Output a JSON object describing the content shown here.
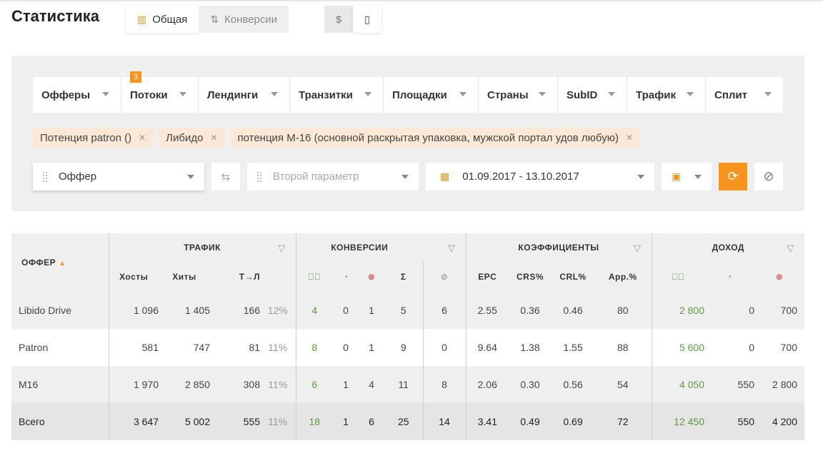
{
  "header": {
    "title": "Статистика",
    "tabs": [
      {
        "label": "Общая",
        "icon": "bar-chart-icon",
        "active": true
      },
      {
        "label": "Конверсии",
        "icon": "sort-arrows-icon",
        "active": false
      }
    ],
    "currency": [
      "$",
      "▯"
    ]
  },
  "filters": {
    "items": [
      {
        "label": "Офферы"
      },
      {
        "label": "Потоки",
        "badge": "3"
      },
      {
        "label": "Лендинги"
      },
      {
        "label": "Транзитки"
      },
      {
        "label": "Площадки"
      },
      {
        "label": "Страны"
      },
      {
        "label": "SubID"
      },
      {
        "label": "Трафик"
      },
      {
        "label": "Сплит"
      }
    ],
    "chips": [
      "Потенция patron ()",
      "Либидо",
      "потенция М-16 (основной раскрытая упаковка, мужской портал удов любую)"
    ]
  },
  "controls": {
    "primary_param": "Оффер",
    "secondary_param": "Второй параметр",
    "date_range": "01.09.2017 - 13.10.2017"
  },
  "table": {
    "first_col": "ОФФЕР",
    "groups": {
      "traffic": "ТРАФИК",
      "conversions": "КОНВЕРСИИ",
      "coefficients": "КОЭФФИЦИЕНТЫ",
      "income": "ДОХОД"
    },
    "columns": {
      "hosts": "Хосты",
      "hits": "Хиты",
      "tl": "Т→Л",
      "epc": "EPC",
      "crs": "CRS%",
      "crl": "CRL%",
      "app": "App.%"
    },
    "rows": [
      {
        "name": "Libido Drive",
        "hosts": "1 096",
        "hits": "1 405",
        "tl": "166",
        "tl_pct": "12%",
        "conv_ok": "4",
        "conv_wait": "0",
        "conv_rej": "1",
        "conv_sum": "5",
        "blocked": "6",
        "epc": "2.55",
        "crs": "0.36",
        "crl": "0.46",
        "app": "80",
        "inc_ok": "2 800",
        "inc_wait": "0",
        "inc_rej": "700"
      },
      {
        "name": "Patron",
        "hosts": "581",
        "hits": "747",
        "tl": "81",
        "tl_pct": "11%",
        "conv_ok": "8",
        "conv_wait": "0",
        "conv_rej": "1",
        "conv_sum": "9",
        "blocked": "0",
        "epc": "9.64",
        "crs": "1.38",
        "crl": "1.55",
        "app": "88",
        "inc_ok": "5 600",
        "inc_wait": "0",
        "inc_rej": "700"
      },
      {
        "name": "M16",
        "hosts": "1 970",
        "hits": "2 850",
        "tl": "308",
        "tl_pct": "11%",
        "conv_ok": "6",
        "conv_wait": "1",
        "conv_rej": "4",
        "conv_sum": "11",
        "blocked": "8",
        "epc": "2.06",
        "crs": "0.30",
        "crl": "0.56",
        "app": "54",
        "inc_ok": "4 050",
        "inc_wait": "550",
        "inc_rej": "2 800"
      }
    ],
    "total": {
      "name": "Всего",
      "hosts": "3 647",
      "hits": "5 002",
      "tl": "555",
      "tl_pct": "11%",
      "conv_ok": "18",
      "conv_wait": "1",
      "conv_rej": "6",
      "conv_sum": "25",
      "blocked": "14",
      "epc": "3.41",
      "crs": "0.49",
      "crl": "0.69",
      "app": "72",
      "inc_ok": "12 450",
      "inc_wait": "550",
      "inc_rej": "4 200"
    }
  }
}
